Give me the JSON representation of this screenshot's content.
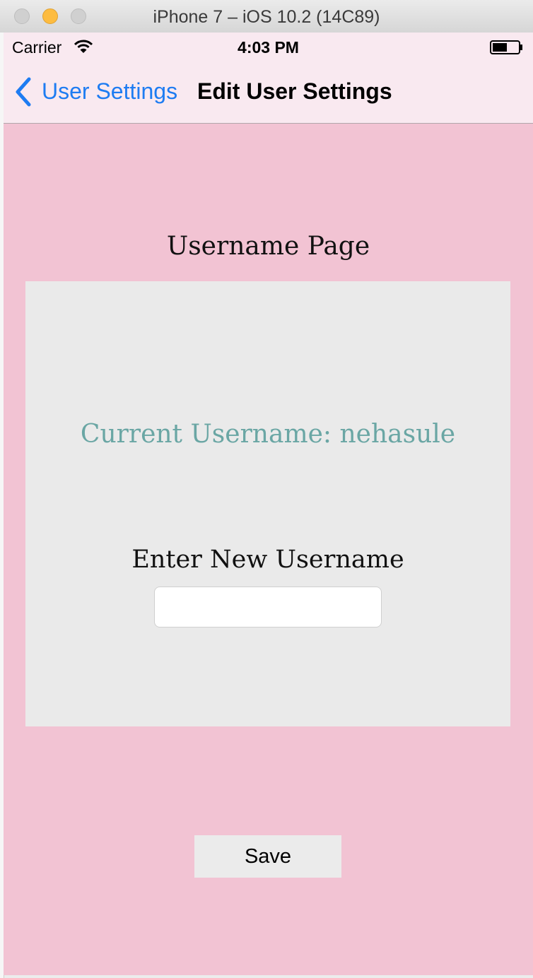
{
  "window": {
    "title": "iPhone 7 – iOS 10.2 (14C89)"
  },
  "status_bar": {
    "carrier": "Carrier",
    "time": "4:03 PM",
    "icons": [
      "wifi-icon",
      "battery-icon"
    ]
  },
  "nav_bar": {
    "back_label": "User Settings",
    "title": "Edit User Settings",
    "back_icon": "chevron-left-icon"
  },
  "content": {
    "heading": "Username Page",
    "current_username": "Current Username: nehasule",
    "new_username_label": "Enter New Username",
    "new_username_value": "",
    "save_label": "Save"
  },
  "colors": {
    "screen_background": "#f2c3d3",
    "bar_background": "#f9e9f0",
    "card_background": "#eaeaea",
    "link_blue": "#1e7cf2",
    "current_username_text": "#6aa6a4"
  }
}
